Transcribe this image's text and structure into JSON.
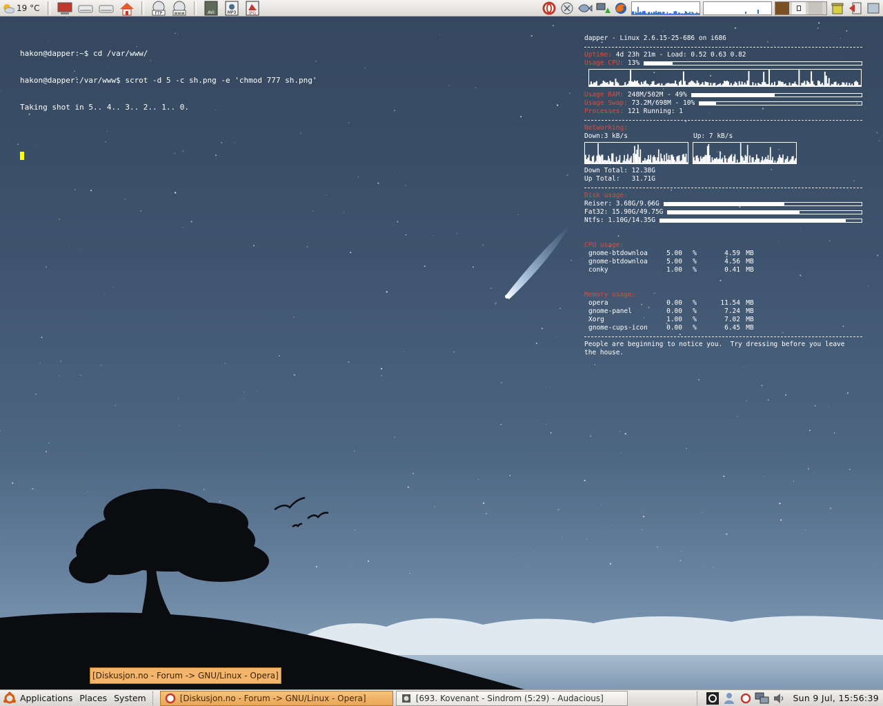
{
  "top_panel": {
    "weather_temp": "19 °C",
    "launchers_left": [
      "computer-icon",
      "drive-icon",
      "drive-2-icon",
      "home-icon"
    ],
    "launchers_web": [
      {
        "name": "ftp-icon",
        "label": "FTP"
      },
      {
        "name": "www-icon",
        "label": "www"
      }
    ],
    "launchers_media": [
      {
        "name": "avi-icon",
        "label": "AVI"
      },
      {
        "name": "mp3-icon",
        "label": "MP3"
      },
      {
        "name": "jpg-icon",
        "label": "JPG"
      }
    ],
    "launchers_apps": [
      "opera-icon",
      "gaim-icon",
      "gnome-fish-icon",
      "network-icon",
      "firefox-icon"
    ],
    "colors": {
      "accent": "#e04a3a"
    }
  },
  "terminal": {
    "lines": [
      "hakon@dapper:~$ cd /var/www/",
      "hakon@dapper:/var/www$ scrot -d 5 -c sh.png -e 'chmod 777 sh.png'",
      "Taking shot in 5.. 4.. 3.. 2.. 1.. 0."
    ]
  },
  "conky": {
    "header": "dapper - Linux 2.6.15-25-686 on i686",
    "uptime_label": "Uptime:",
    "uptime_value": " 4d 23h 21m - Load: 0.52 0.63 0.82",
    "cpu_label": "Usage CPU:",
    "cpu_value": " 13%",
    "cpu_fraction": 0.13,
    "ram_label": "Usage RAM:",
    "ram_value": " 248M/502M - 49%",
    "ram_fraction": 0.49,
    "swap_label": "Usage Swap:",
    "swap_value": " 73.2M/698M - 10%",
    "swap_fraction": 0.1,
    "processes_label": "Processes:",
    "processes_value": " 121 Running: 1",
    "net_label": "Networking:",
    "down_label": "Down:3 kB/s",
    "up_label": "Up: 7 kB/s",
    "down_total": "Down Total: 12.38G",
    "up_total": "Up Total:   31.71G",
    "disk_label": "Disk usage:",
    "disks": [
      {
        "label": "Reiser: 3.68G/9.66G",
        "fraction": 0.61
      },
      {
        "label": "Fat32: 15.90G/49.75G",
        "fraction": 0.68
      },
      {
        "label": "Ntfs: 1.10G/14.35G",
        "fraction": 0.92
      }
    ],
    "cpu_top_label": "CPU usage:",
    "cpu_top": [
      {
        "name": "gnome-btdownloa",
        "cpu": "5.00",
        "pct": "%",
        "mem": "4.59",
        "unit": "MB"
      },
      {
        "name": "gnome-btdownloa",
        "cpu": "5.00",
        "pct": "%",
        "mem": "4.56",
        "unit": "MB"
      },
      {
        "name": "conky",
        "cpu": "1.00",
        "pct": "%",
        "mem": "0.41",
        "unit": "MB"
      }
    ],
    "mem_top_label": "Memory usage:",
    "mem_top": [
      {
        "name": "opera",
        "cpu": "0.00",
        "pct": "%",
        "mem": "11.54",
        "unit": "MB"
      },
      {
        "name": "gnome-panel",
        "cpu": "0.00",
        "pct": "%",
        "mem": "7.24",
        "unit": "MB"
      },
      {
        "name": "Xorg",
        "cpu": "1.00",
        "pct": "%",
        "mem": "7.02",
        "unit": "MB"
      },
      {
        "name": "gnome-cups-icon",
        "cpu": "0.00",
        "pct": "%",
        "mem": "6.45",
        "unit": "MB"
      }
    ],
    "fortune_line1": "People are beginning to notice you.  Try dressing before you leave",
    "fortune_line2": "the house."
  },
  "bottom_panel": {
    "menu_applications": "Applications",
    "menu_places": "Places",
    "menu_system": "System",
    "task_opera": "[Diskusjon.no - Forum -> GNU/Linux - Opera]",
    "task_audacious": "[693. Kovenant - Sindrom (5:29) - Audacious]",
    "clock": "Sun  9 Jul, 15:56:39"
  },
  "tooltip": "[Diskusjon.no - Forum -> GNU/Linux - Opera]"
}
